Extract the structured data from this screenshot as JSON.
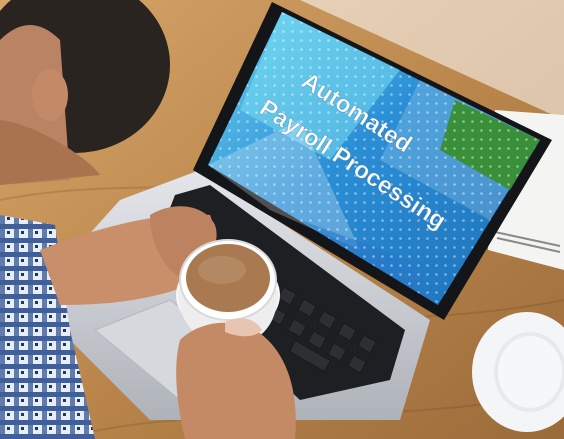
{
  "screen": {
    "line1": "Automated",
    "line2": "Payroll Processing"
  },
  "colors": {
    "desk": "#b8844a",
    "screen_blue": "#2a8fd6",
    "screen_cyan": "#56c6e8",
    "screen_green": "#3a8f3a",
    "laptop_silver": "#c9ccd1",
    "shirt_blue": "#3e5f9a",
    "skin": "#c98f6a",
    "coffee": "#a9794f"
  }
}
